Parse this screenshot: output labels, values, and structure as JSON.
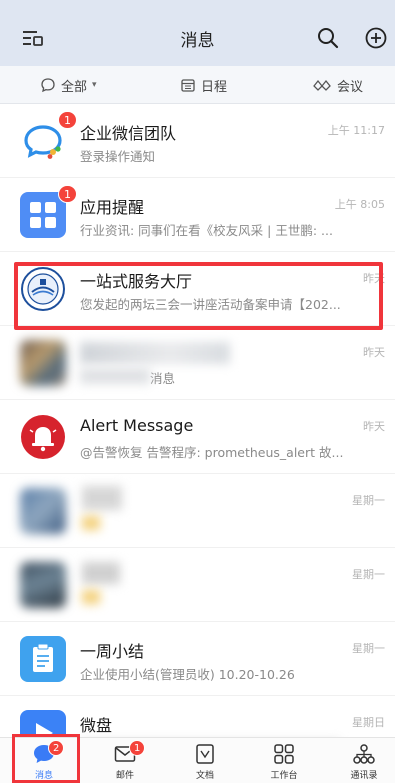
{
  "header": {
    "title": "消息",
    "menu_icon": "menu-icon",
    "search_icon": "search-icon",
    "add_icon": "plus-circle-icon"
  },
  "filters": {
    "all": "全部",
    "schedule": "日程",
    "meeting": "会议"
  },
  "conversations": [
    {
      "name": "企业微信团队",
      "preview": "登录操作通知",
      "time": "上午 11:17",
      "badge": "1"
    },
    {
      "name": "应用提醒",
      "preview": "行业资讯: 同事们在看《校友风采 | 王世鹏: ...",
      "time": "上午 8:05",
      "badge": "1"
    },
    {
      "name": "一站式服务大厅",
      "preview": "您发起的两坛三会一讲座活动备案申请【202...",
      "time": "昨天"
    },
    {
      "name": "",
      "preview": "消息",
      "time": "昨天"
    },
    {
      "name": "Alert Message",
      "preview": "@告警恢复 告警程序: prometheus_alert 故...",
      "time": "昨天"
    },
    {
      "name": "",
      "preview": "",
      "time": "星期一"
    },
    {
      "name": "",
      "preview": "",
      "time": "星期一"
    },
    {
      "name": "一周小结",
      "preview": "企业使用小结(管理员收) 10.20-10.26",
      "time": "星期一"
    },
    {
      "name": "微盘",
      "preview": "",
      "time": "星期日"
    }
  ],
  "tabs": [
    {
      "label": "消息",
      "badge": "2"
    },
    {
      "label": "邮件",
      "badge": "1"
    },
    {
      "label": "文档"
    },
    {
      "label": "工作台"
    },
    {
      "label": "通讯录"
    }
  ],
  "colors": {
    "accent": "#3a7bf6",
    "badge": "#f4433b",
    "highlight": "#f0353b",
    "header_bg": "#dfe6f2"
  }
}
